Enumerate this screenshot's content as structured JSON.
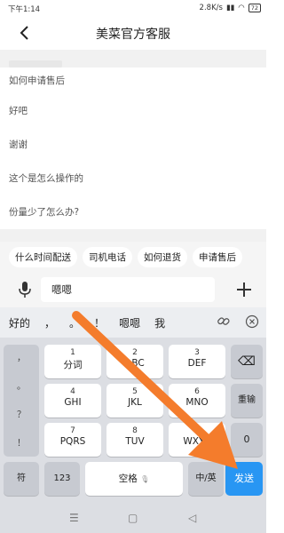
{
  "status": {
    "time": "下午1:14",
    "speed": "2.8K/s",
    "battery": "72"
  },
  "header": {
    "title": "美菜官方客服"
  },
  "faq": [
    "如何申请售后",
    "好吧",
    "谢谢",
    "这个是怎么操作的",
    "份量少了怎么办?"
  ],
  "chips": [
    "什么时间配送",
    "司机电话",
    "如何退货",
    "申请售后"
  ],
  "input": {
    "value": "嗯嗯"
  },
  "keyboard": {
    "candidates": [
      "好的",
      "，",
      "。",
      "！",
      "嗯嗯",
      "我"
    ],
    "side_punct": [
      "，",
      "。",
      "？",
      "！"
    ],
    "keys": [
      {
        "num": "1",
        "lbl": "分词"
      },
      {
        "num": "2",
        "lbl": "ABC"
      },
      {
        "num": "3",
        "lbl": "DEF"
      },
      {
        "num": "4",
        "lbl": "GHI"
      },
      {
        "num": "5",
        "lbl": "JKL"
      },
      {
        "num": "6",
        "lbl": "MNO"
      },
      {
        "num": "7",
        "lbl": "PQRS"
      },
      {
        "num": "8",
        "lbl": "TUV"
      },
      {
        "num": "9",
        "lbl": "WXYZ"
      }
    ],
    "backspace": "⌫",
    "retype": "重输",
    "zero": "0",
    "fu": "符",
    "num123": "123",
    "space": "空格",
    "lang": "中/英",
    "send": "发送"
  },
  "icons": {
    "back": "back-chevron-icon",
    "mic": "microphone-icon",
    "plus": "plus-icon",
    "link": "link-icon",
    "close": "close-circle-icon"
  },
  "colors": {
    "send": "#2896f3",
    "arrow": "#f47c2c"
  }
}
